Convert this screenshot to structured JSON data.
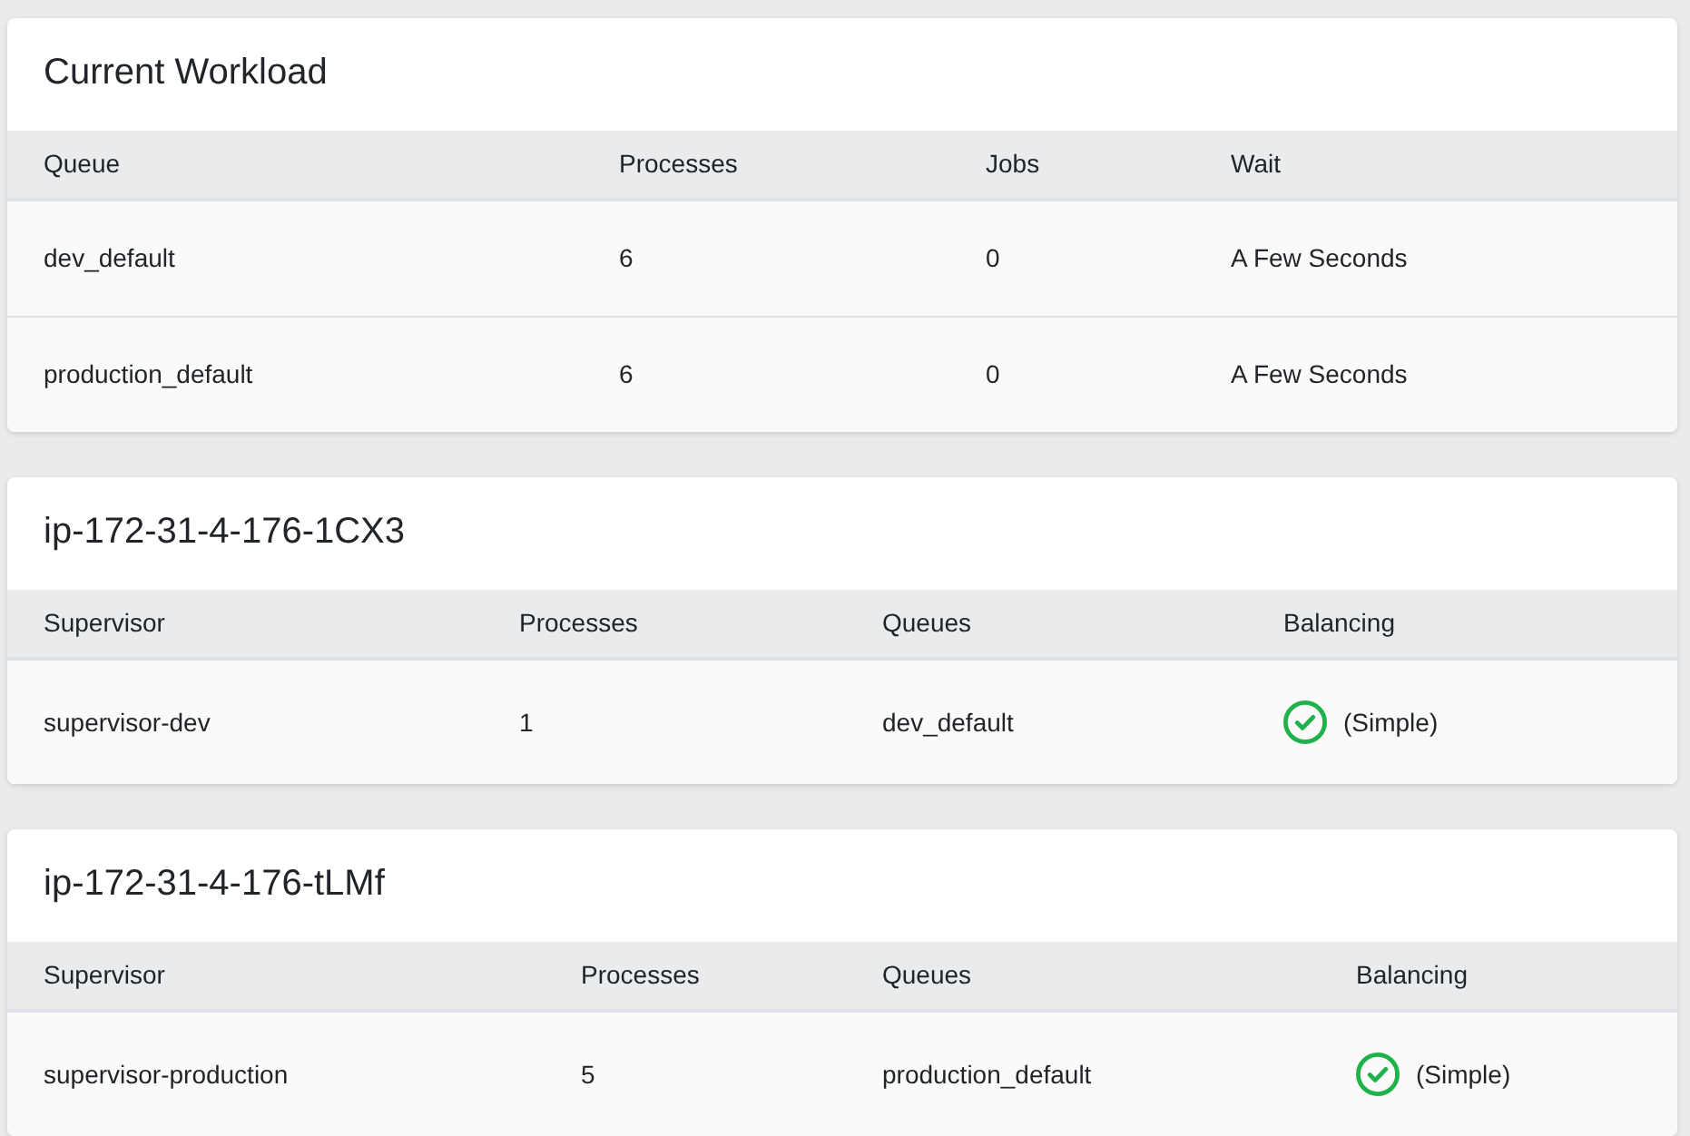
{
  "cards": [
    {
      "title": "Current Workload",
      "columns": [
        "Queue",
        "Processes",
        "Jobs",
        "Wait"
      ],
      "rows": [
        {
          "cells": [
            {
              "kind": "text",
              "text": "dev_default"
            },
            {
              "kind": "text",
              "text": "6"
            },
            {
              "kind": "text",
              "text": "0"
            },
            {
              "kind": "text",
              "text": "A Few Seconds"
            }
          ]
        },
        {
          "cells": [
            {
              "kind": "text",
              "text": "production_default"
            },
            {
              "kind": "text",
              "text": "6"
            },
            {
              "kind": "text",
              "text": "0"
            },
            {
              "kind": "text",
              "text": "A Few Seconds"
            }
          ]
        }
      ]
    },
    {
      "title": "ip-172-31-4-176-1CX3",
      "columns": [
        "Supervisor",
        "Processes",
        "Queues",
        "Balancing"
      ],
      "rows": [
        {
          "cells": [
            {
              "kind": "text",
              "text": "supervisor-dev"
            },
            {
              "kind": "text",
              "text": "1"
            },
            {
              "kind": "text",
              "text": "dev_default"
            },
            {
              "kind": "check",
              "text": "(Simple)"
            }
          ]
        }
      ]
    },
    {
      "title": "ip-172-31-4-176-tLMf",
      "columns": [
        "Supervisor",
        "Processes",
        "Queues",
        "Balancing"
      ],
      "rows": [
        {
          "cells": [
            {
              "kind": "text",
              "text": "supervisor-production"
            },
            {
              "kind": "text",
              "text": "5"
            },
            {
              "kind": "text",
              "text": "production_default"
            },
            {
              "kind": "check",
              "text": "(Simple)"
            }
          ]
        }
      ]
    }
  ]
}
